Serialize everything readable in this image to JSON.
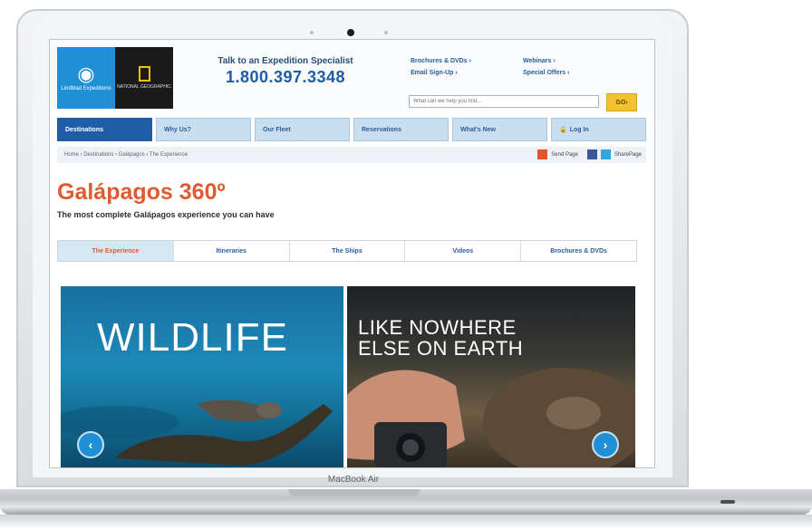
{
  "device": {
    "label": "MacBook Air"
  },
  "header": {
    "lindblad_logo_text": "Lindblad Expeditions",
    "natgeo_logo_text": "NATIONAL GEOGRAPHIC",
    "talk_label": "Talk to an Expedition Specialist",
    "phone": "1.800.397.3348",
    "links": {
      "brochures": "Brochures & DVDs ›",
      "email": "Email Sign-Up ›",
      "webinars": "Webinars ›",
      "offers": "Special Offers ›"
    },
    "search": {
      "placeholder": "What can we help you find...",
      "button": "GO›"
    }
  },
  "nav": {
    "items": [
      {
        "label": "Destinations"
      },
      {
        "label": "Why Us?"
      },
      {
        "label": "Our Fleet"
      },
      {
        "label": "Reservations"
      },
      {
        "label": "What's New"
      },
      {
        "label": "Log In"
      }
    ]
  },
  "breadcrumb": "Home › Destinations › Galápagos › The Experience",
  "share": {
    "send": "Send Page",
    "share": "SharePage"
  },
  "page": {
    "title": "Galápagos 360º",
    "subtitle": "The most complete Galápagos experience you can have"
  },
  "tabs": [
    {
      "label": "The Experience"
    },
    {
      "label": "Itineraries"
    },
    {
      "label": "The Ships"
    },
    {
      "label": "Videos"
    },
    {
      "label": "Brochures & DVDs"
    }
  ],
  "hero": {
    "left_text": "WILDLIFE",
    "right_text_line1": "LIKE NOWHERE",
    "right_text_line2": "ELSE ON EARTH",
    "prev": "‹",
    "next": "›"
  },
  "colors": {
    "accent": "#e05a32",
    "brand_blue": "#1f5ea6",
    "nav_bg": "#c9dff0",
    "go_button": "#f2c230"
  }
}
